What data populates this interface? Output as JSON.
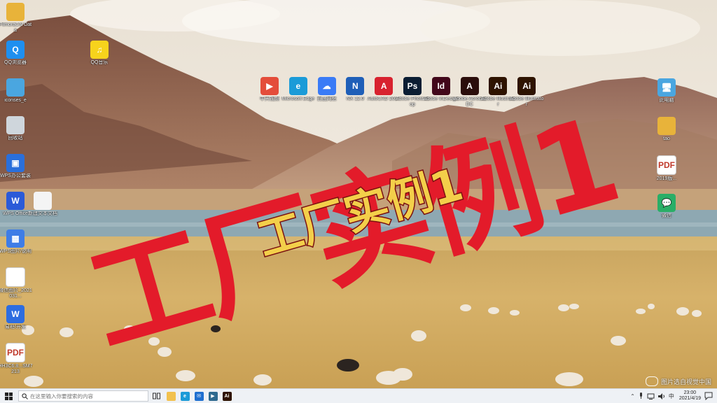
{
  "colors": {
    "sky": "#f2ede4",
    "mountain": "#8a5e4b",
    "lake": "#8ca7b4",
    "field": "#d8b064",
    "overlay_red": "#e31b2a",
    "overlay_yellow": "#f3cf4a",
    "taskbar": "#eef1f5"
  },
  "overlay": {
    "big_text": "工厂实例1",
    "small_text": "工厂实例1"
  },
  "desktop_left": [
    {
      "label": "FilmoraCN Data",
      "icon": "folder-doc-icon",
      "color": "#e8b33a",
      "glyph": ""
    },
    {
      "label": "QQ浏览器",
      "icon": "qq-browser-icon",
      "color": "#1e8ff0",
      "glyph": "Q"
    },
    {
      "label": "iconses_e",
      "icon": "doc-icon",
      "color": "#4aa6e0",
      "glyph": ""
    },
    {
      "label": "回收站",
      "icon": "recycle-bin-icon",
      "color": "#cfd6dc",
      "glyph": ""
    },
    {
      "label": "WPS办公套装",
      "icon": "wps-cube-icon",
      "color": "#2a6fdb",
      "glyph": "▣"
    },
    {
      "label": "WPS Office",
      "icon": "wps-office-icon",
      "color": "#2b5ad8",
      "glyph": "W"
    },
    {
      "label": "WPS图片/说明",
      "icon": "wps-grid-icon",
      "color": "#3f7de6",
      "glyph": "▦"
    },
    {
      "label": "微信图片_2021031...",
      "icon": "qr-image-icon",
      "color": "#ffffff",
      "glyph": ""
    },
    {
      "label": "易班/开发",
      "icon": "app-w-icon",
      "color": "#2d6de0",
      "glyph": "W"
    },
    {
      "label": "HH3C6.8...SM7213",
      "icon": "pdf-file-icon",
      "color": "#ffffff",
      "glyph": "PDF"
    }
  ],
  "desktop_left2": [
    {
      "label": "QQ音乐",
      "icon": "qq-music-icon",
      "color": "#f7d31c",
      "glyph": "♫"
    },
    {
      "label": "新建文本文档",
      "icon": "text-file-icon",
      "color": "#f4f4f4",
      "glyph": ""
    }
  ],
  "desktop_top": [
    {
      "label": "中天视频",
      "icon": "video-play-icon",
      "color": "#e44d3a",
      "glyph": "▶"
    },
    {
      "label": "Microsoft Edge",
      "icon": "edge-icon",
      "color": "#1b9bd8",
      "glyph": "e"
    },
    {
      "label": "百度网盘",
      "icon": "cloud-drive-icon",
      "color": "#3a7bf6",
      "glyph": "☁"
    },
    {
      "label": "NX 12.0",
      "icon": "nx-icon",
      "color": "#1f5fb8",
      "glyph": "N"
    },
    {
      "label": "AutoCAD 2017",
      "icon": "autocad-icon",
      "color": "#d8222f",
      "glyph": "A"
    },
    {
      "label": "Adobe Photoshop",
      "icon": "photoshop-icon",
      "color": "#0b1d33",
      "glyph": "Ps"
    },
    {
      "label": "Adobe InDesign",
      "icon": "indesign-icon",
      "color": "#42071b",
      "glyph": "Id"
    },
    {
      "label": "Adobe Acrobat DC",
      "icon": "acrobat-icon",
      "color": "#2b0d0b",
      "glyph": "A"
    },
    {
      "label": "Adobe Illustrator",
      "icon": "illustrator-icon",
      "color": "#2e1300",
      "glyph": "Ai"
    },
    {
      "label": "Adobe Illustrator",
      "icon": "illustrator-icon",
      "color": "#2e1300",
      "glyph": "Ai"
    }
  ],
  "desktop_right": [
    {
      "label": "此电脑",
      "icon": "this-pc-icon",
      "color": "#4aa6e0",
      "glyph": "🖥"
    },
    {
      "label": "tao",
      "icon": "user-folder-icon",
      "color": "#e8b33a",
      "glyph": ""
    },
    {
      "label": "2019版...",
      "icon": "pdf-file-icon",
      "color": "#ffffff",
      "glyph": "PDF"
    },
    {
      "label": "微信",
      "icon": "wechat-icon",
      "color": "#2aae67",
      "glyph": "💬"
    }
  ],
  "watermark": {
    "text": "图片选自视觉中国"
  },
  "taskbar": {
    "search_placeholder": "在这里输入你要搜索的内容",
    "time": "23:00",
    "date": "2021/4/19",
    "lang": "中",
    "apps": [
      {
        "icon": "file-explorer-icon",
        "color": "#f2c14e",
        "glyph": ""
      },
      {
        "icon": "edge-icon",
        "color": "#1b9bd8",
        "glyph": "e"
      },
      {
        "icon": "mail-icon",
        "color": "#1f6fd0",
        "glyph": "✉"
      },
      {
        "icon": "video-play-icon",
        "color": "#2f6a8f",
        "glyph": "▶"
      },
      {
        "icon": "illustrator-icon",
        "color": "#2e1300",
        "glyph": "Ai"
      }
    ]
  }
}
